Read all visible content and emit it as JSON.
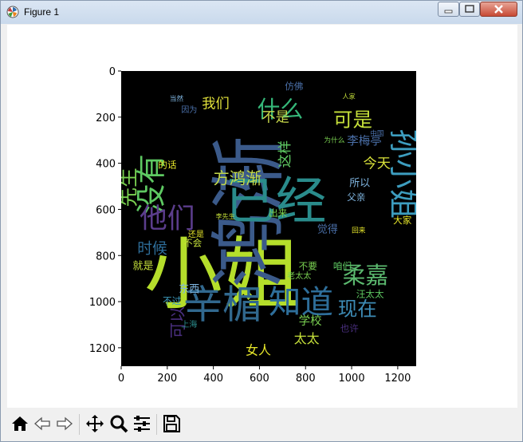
{
  "window": {
    "title": "Figure 1",
    "controls": {
      "minimize": "minimize",
      "maximize": "maximize",
      "close": "close"
    }
  },
  "toolbar": {
    "tools": [
      {
        "name": "home",
        "icon": "home-icon"
      },
      {
        "name": "back",
        "icon": "back-arrow-icon"
      },
      {
        "name": "forward",
        "icon": "forward-arrow-icon"
      },
      {
        "name": "pan",
        "icon": "move-icon"
      },
      {
        "name": "zoom",
        "icon": "zoom-icon"
      },
      {
        "name": "configure-subplots",
        "icon": "sliders-icon"
      },
      {
        "name": "save",
        "icon": "save-icon"
      }
    ]
  },
  "chart_data": {
    "type": "image",
    "x_ticks": [
      "0",
      "200",
      "400",
      "600",
      "800",
      "1000",
      "1200"
    ],
    "y_ticks": [
      "0",
      "200",
      "400",
      "600",
      "800",
      "1000",
      "1200"
    ],
    "xlim": [
      0,
      1280
    ],
    "ylim": [
      1280,
      0
    ],
    "background": "#000000",
    "words": [
      {
        "text": "小姐",
        "x": 100,
        "y": 1000,
        "size": 340,
        "rot": 0,
        "color": "#b5de2b"
      },
      {
        "text": "鸿渐",
        "x": 670,
        "y": 940,
        "size": 330,
        "rot": -90,
        "color": "#3b5a8a"
      },
      {
        "text": "辛楣",
        "x": 270,
        "y": 1070,
        "size": 170,
        "rot": 0,
        "color": "#31688e"
      },
      {
        "text": "已经",
        "x": 450,
        "y": 640,
        "size": 220,
        "rot": 0,
        "color": "#2a8c8c"
      },
      {
        "text": "孙小姐",
        "x": 1180,
        "y": 250,
        "size": 130,
        "rot": 90,
        "color": "#3d9dbf"
      },
      {
        "text": "知道",
        "x": 640,
        "y": 1050,
        "size": 140,
        "rot": 0,
        "color": "#2e6e9a"
      },
      {
        "text": "没有",
        "x": 175,
        "y": 620,
        "size": 130,
        "rot": -90,
        "color": "#5ec962"
      },
      {
        "text": "他们",
        "x": 80,
        "y": 680,
        "size": 120,
        "rot": 0,
        "color": "#5b3d8c"
      },
      {
        "text": "柔嘉",
        "x": 960,
        "y": 920,
        "size": 100,
        "rot": 0,
        "color": "#5bb86e"
      },
      {
        "text": "什么",
        "x": 590,
        "y": 200,
        "size": 100,
        "rot": 0,
        "color": "#35b779"
      },
      {
        "text": "可是",
        "x": 920,
        "y": 240,
        "size": 85,
        "rot": 0,
        "color": "#c5df3a"
      },
      {
        "text": "现在",
        "x": 940,
        "y": 1060,
        "size": 85,
        "rot": 0,
        "color": "#3d8bb5"
      },
      {
        "text": "先生",
        "x": 60,
        "y": 590,
        "size": 85,
        "rot": -90,
        "color": "#7ad151"
      },
      {
        "text": "方鸿渐",
        "x": 400,
        "y": 490,
        "size": 70,
        "rot": 0,
        "color": "#c3d94a"
      },
      {
        "text": "时候",
        "x": 70,
        "y": 790,
        "size": 65,
        "rot": 0,
        "color": "#2e6e9a"
      },
      {
        "text": "可以",
        "x": 270,
        "y": 1160,
        "size": 70,
        "rot": -90,
        "color": "#4a2f7f"
      },
      {
        "text": "我们",
        "x": 350,
        "y": 160,
        "size": 60,
        "rot": 0,
        "color": "#e0e03a"
      },
      {
        "text": "不是",
        "x": 610,
        "y": 220,
        "size": 60,
        "rot": 0,
        "color": "#c8d94a"
      },
      {
        "text": "这样",
        "x": 730,
        "y": 420,
        "size": 60,
        "rot": -90,
        "color": "#5ec962"
      },
      {
        "text": "今天",
        "x": 1050,
        "y": 420,
        "size": 60,
        "rot": 0,
        "color": "#d9e23a"
      },
      {
        "text": "李梅亭",
        "x": 980,
        "y": 320,
        "size": 50,
        "rot": 0,
        "color": "#4a6fa8"
      },
      {
        "text": "太太",
        "x": 750,
        "y": 1180,
        "size": 55,
        "rot": 0,
        "color": "#c5df3a"
      },
      {
        "text": "女人",
        "x": 540,
        "y": 1230,
        "size": 55,
        "rot": 0,
        "color": "#e8e82a"
      },
      {
        "text": "学校",
        "x": 770,
        "y": 1100,
        "size": 50,
        "rot": 0,
        "color": "#7ad151"
      },
      {
        "text": "所以",
        "x": 990,
        "y": 500,
        "size": 45,
        "rot": 0,
        "color": "#7fb5e0"
      },
      {
        "text": "汪太太",
        "x": 1020,
        "y": 980,
        "size": 40,
        "rot": 0,
        "color": "#5ec962"
      },
      {
        "text": "东西",
        "x": 250,
        "y": 960,
        "size": 45,
        "rot": 0,
        "color": "#7fb5e0"
      },
      {
        "text": "就是",
        "x": 50,
        "y": 860,
        "size": 45,
        "rot": 0,
        "color": "#c5df3a"
      },
      {
        "text": "觉得",
        "x": 850,
        "y": 700,
        "size": 45,
        "rot": 0,
        "color": "#4a6fa8"
      },
      {
        "text": "也许",
        "x": 950,
        "y": 1130,
        "size": 40,
        "rot": 0,
        "color": "#4a2f7f"
      },
      {
        "text": "上海",
        "x": 260,
        "y": 1110,
        "size": 35,
        "rot": 0,
        "color": "#2a8c8c"
      },
      {
        "text": "不会",
        "x": 270,
        "y": 760,
        "size": 40,
        "rot": 0,
        "color": "#c5df3a"
      },
      {
        "text": "还是",
        "x": 290,
        "y": 720,
        "size": 35,
        "rot": 0,
        "color": "#e8e82a"
      },
      {
        "text": "不要",
        "x": 770,
        "y": 860,
        "size": 40,
        "rot": 0,
        "color": "#7ad151"
      },
      {
        "text": "咱们",
        "x": 920,
        "y": 860,
        "size": 40,
        "rot": 0,
        "color": "#5ec962"
      },
      {
        "text": "中国",
        "x": 1080,
        "y": 280,
        "size": 30,
        "rot": 0,
        "color": "#4a6fa8"
      },
      {
        "text": "大家",
        "x": 1180,
        "y": 660,
        "size": 40,
        "rot": 0,
        "color": "#e8e82a"
      },
      {
        "text": "仿佛",
        "x": 710,
        "y": 80,
        "size": 40,
        "rot": 0,
        "color": "#4a6fa8"
      },
      {
        "text": "父亲",
        "x": 980,
        "y": 560,
        "size": 40,
        "rot": 0,
        "color": "#7fb5e0"
      },
      {
        "text": "因为",
        "x": 260,
        "y": 180,
        "size": 35,
        "rot": 0,
        "color": "#4a6fa8"
      },
      {
        "text": "当然",
        "x": 210,
        "y": 130,
        "size": 30,
        "rot": 0,
        "color": "#7fb5e0"
      },
      {
        "text": "出来",
        "x": 640,
        "y": 630,
        "size": 40,
        "rot": 0,
        "color": "#7ad151"
      },
      {
        "text": "回来",
        "x": 1000,
        "y": 700,
        "size": 30,
        "rot": 0,
        "color": "#e8e82a"
      },
      {
        "text": "老太太",
        "x": 720,
        "y": 900,
        "size": 35,
        "rot": 0,
        "color": "#7ad151"
      },
      {
        "text": "为什么",
        "x": 880,
        "y": 310,
        "size": 30,
        "rot": 0,
        "color": "#7ad151"
      },
      {
        "text": "的话",
        "x": 160,
        "y": 420,
        "size": 40,
        "rot": 0,
        "color": "#e8e82a"
      },
      {
        "text": "李先生",
        "x": 410,
        "y": 640,
        "size": 28,
        "rot": 0,
        "color": "#c5df3a"
      },
      {
        "text": "人家",
        "x": 960,
        "y": 120,
        "size": 28,
        "rot": 0,
        "color": "#c5df3a"
      },
      {
        "text": "不过",
        "x": 180,
        "y": 1010,
        "size": 40,
        "rot": 0,
        "color": "#3d9dbf"
      }
    ]
  }
}
